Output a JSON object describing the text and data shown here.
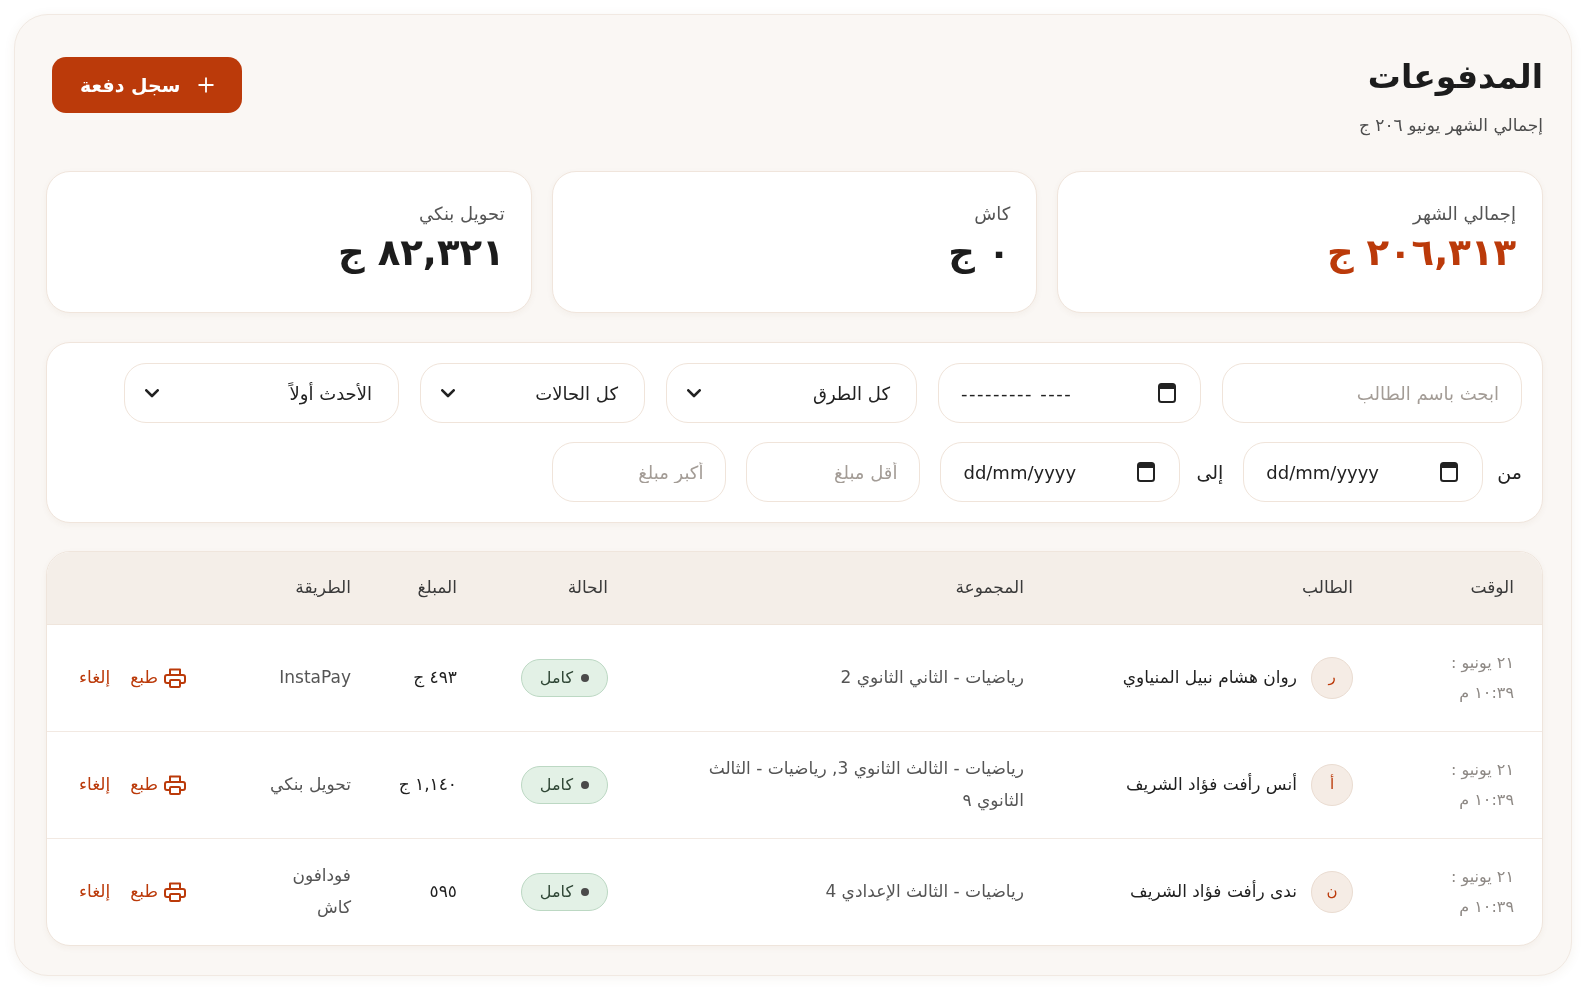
{
  "header": {
    "title": "المدفوعات",
    "subtitle": "إجمالي الشهر يونيو ٢٠٦ ج",
    "add_button": "سجل دفعة"
  },
  "stats": [
    {
      "label": "إجمالي الشهر",
      "value": "٢٠٦,٣١٣ ج",
      "highlight": true
    },
    {
      "label": "كاش",
      "value": "٠ ج",
      "highlight": false
    },
    {
      "label": "تحويل بنكي",
      "value": "٨٢,٣٢١ ج",
      "highlight": false
    }
  ],
  "filters": {
    "search": {
      "placeholder": "ابحث باسم الطالب"
    },
    "month": {
      "placeholder": "--------- ----"
    },
    "method": {
      "value": "كل الطرق"
    },
    "status": {
      "value": "كل الحالات"
    },
    "sort": {
      "value": "الأحدث أولاً"
    },
    "from_label": "من",
    "from_date": {
      "placeholder": "dd/mm/yyyy"
    },
    "to_label": "إلى",
    "to_date": {
      "placeholder": "dd/mm/yyyy"
    },
    "min_amount": {
      "placeholder": "أقل مبلغ"
    },
    "max_amount": {
      "placeholder": "أكبر مبلغ"
    }
  },
  "table": {
    "columns": [
      "الوقت",
      "الطالب",
      "المجموعة",
      "الحالة",
      "المبلغ",
      "الطريقة"
    ],
    "rows": [
      {
        "time": "٢١ يونيو : ١٠:٣٩ م",
        "initial": "ر",
        "student": "روان هشام نبيل المنياوي",
        "group": "رياضيات - الثاني الثانوي 2",
        "status": "كامل",
        "amount": "٤٩٣ ج",
        "method": "InstaPay",
        "print": "طبع",
        "cancel": "إلغاء"
      },
      {
        "time": "٢١ يونيو : ١٠:٣٩ م",
        "initial": "أ",
        "student": "أنس رأفت فؤاد الشريف",
        "group": "رياضيات - الثالث الثانوي 3, رياضيات - الثالث الثانوي ٩",
        "status": "كامل",
        "amount": "١,١٤٠ ج",
        "method": "تحويل بنكي",
        "print": "طبع",
        "cancel": "إلغاء"
      },
      {
        "time": "٢١ يونيو : ١٠:٣٩ م",
        "initial": "ن",
        "student": "ندى رأفت فؤاد الشريف",
        "group": "رياضيات - الثالث الإعدادي 4",
        "status": "كامل",
        "amount": "٥٩٥",
        "method": "فودافون كاش",
        "print": "طبع",
        "cancel": "إلغاء"
      }
    ]
  }
}
